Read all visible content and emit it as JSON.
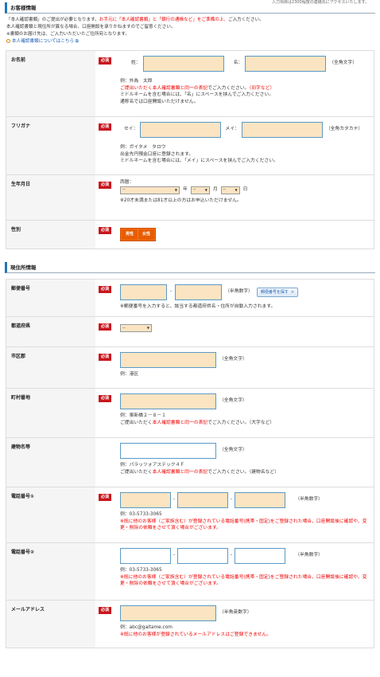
{
  "top_note": "入力項目は2300程度の連絡先にアクセスいたします。",
  "customer": {
    "title": "お客様情報",
    "intro1a": "「本人確認書類」のご提出が必要となります。",
    "intro1b": "お手元に「本人確認書類」と「銀行の通帳など」をご準備の上、",
    "intro1c": "ご入力ください。",
    "intro2": "本人確認書類と現住所が異なる場合、口座開設を承りかねますのでご留意ください。",
    "intro3": "※書類のお届け先は、ご入力いただいたご住所宛となります。",
    "intro_link": "本人確認書類についてはこちら"
  },
  "required": "必須",
  "name": {
    "label": "お名前",
    "sei": "姓：",
    "mei": "名：",
    "note": "（全角文字）",
    "hint1": "例：外為　太郎",
    "hint2a": "ご提出いただく",
    "hint2b": "本人確認書類と同一の表記",
    "hint2c": "でご入力ください。",
    "hint2d": "（旧字など）",
    "hint3": "ミドルネームを含む場合には、「名」にスペースを挟んでご入力ください。",
    "hint4": "通称名では口座開設いただけません。"
  },
  "kana": {
    "label": "フリガナ",
    "sei": "セイ：",
    "mei": "メイ：",
    "note": "（全角カタカナ）",
    "hint1": "例：ガイタメ　タロウ",
    "hint2": "出金先円預金口座に登録されます。",
    "hint3": "ミドルネームを含む場合には、「メイ」にスペースを挟んでご入力ください。"
  },
  "birth": {
    "label": "生年月日",
    "era": "西暦：",
    "year_val": "--",
    "year": "年",
    "month_val": "--",
    "month": "月",
    "day_val": "--",
    "day": "日",
    "hint": "※20才未満または81才以上の方はお申込いただけません。"
  },
  "gender": {
    "label": "性別",
    "male": "男性",
    "female": "女性"
  },
  "address": {
    "title": "現住所情報"
  },
  "zip": {
    "label": "郵便番号",
    "note": "（半角数字）",
    "button": "郵便番号を探す",
    "hint": "※郵便番号を入力すると、該当する都道府県名・住所が自動入力されます。"
  },
  "pref": {
    "label": "都道府県",
    "value": "--"
  },
  "city": {
    "label": "市区郡",
    "note": "（全角文字）",
    "hint": "例：港区"
  },
  "town": {
    "label": "町村番地",
    "note": "（全角文字）",
    "hint1": "例：東新橋２－８－１",
    "hint2a": "ご提出いただく",
    "hint2b": "本人確認書類と同一の表記",
    "hint2c": "でご入力ください。（大字など）"
  },
  "building": {
    "label": "建物名等",
    "note": "（全角文字）",
    "hint1": "例：パラッツォアステック４Ｆ",
    "hint2a": "ご提出いただく",
    "hint2b": "本人確認書類と同一の表記",
    "hint2c": "でご入力ください。（建物名など）"
  },
  "tel1": {
    "label": "電話番号①",
    "note": "（半角数字）",
    "hint1": "例：03-5733-3065",
    "hint2": "※既に他のお客様（ご家族含む）が登録されている電話番号(携帯・固定)をご登録された場合、口座開設後に確認や、変更・削除の依頼をさせて頂く場合がございます。"
  },
  "tel2": {
    "label": "電話番号②",
    "note": "（半角数字）",
    "hint1": "例：03-5733-3065",
    "hint2": "※既に他のお客様（ご家族含む）が登録されている電話番号(携帯・固定)をご登録された場合、口座開設後に確認や、変更・削除の依頼をさせて頂く場合がございます。"
  },
  "mail": {
    "label": "メールアドレス",
    "note": "（半角英数字）",
    "hint1": "例：abc@gaitame.com",
    "hint2": "※既に他のお客様が登録されているメールアドレスはご登録できません。"
  }
}
